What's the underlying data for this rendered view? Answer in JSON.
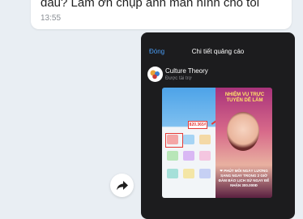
{
  "message_in": {
    "text": "đâu? Làm ơn chụp ảnh màn hình cho tôi",
    "time": "13:55"
  },
  "share_icon": "share-arrow-icon",
  "screenshot": {
    "close_label": "Đóng",
    "title": "Chi tiết quảng cáo",
    "advertiser_name": "Culture Theory",
    "advertiser_sub": "Được tài trợ",
    "ad": {
      "headline": "NHIỆM VỤ TRỰC TUYẾN DỄ LÀM",
      "amount": "820.365₫",
      "bottom_text": "❤ PHÚT MỖI NGÀY LƯƠNG SANG NGAY TRONG 2 GIỜ ĐẢM BẢO LỊCH SỬ NGAY ĐỂ NHẬN 300.000Đ"
    },
    "colors": {
      "link": "#4a9df5",
      "background": "#1c1c1e"
    }
  }
}
